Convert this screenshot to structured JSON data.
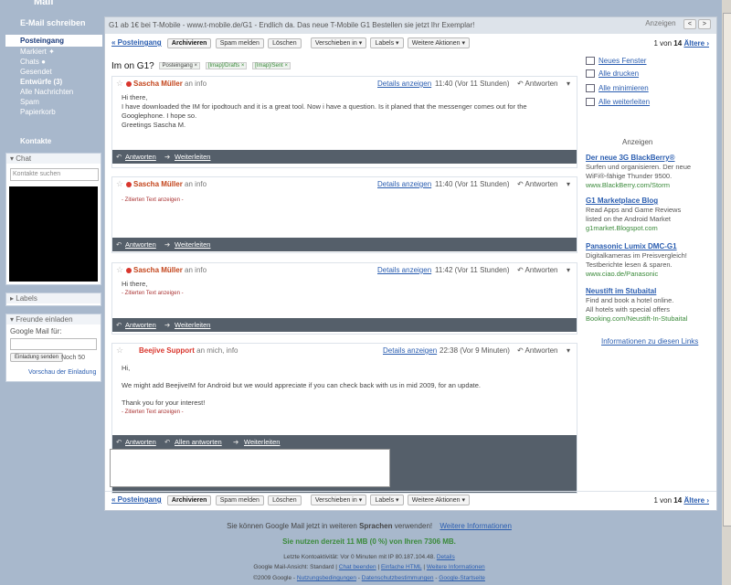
{
  "sidebar": {
    "logo_stub": "Mail",
    "compose": "E-Mail schreiben",
    "nav": [
      "Posteingang",
      "Markiert",
      "Chats",
      "Gesendet",
      "Entwürfe (3)",
      "Alle Nachrichten",
      "Spam",
      "Papierkorb"
    ],
    "contacts": "Kontakte",
    "chat_header": "Chat",
    "chat_search_placeholder": "Kontakte suchen",
    "labels_header": "Labels",
    "invite_header": "Freunde einladen",
    "invite_text": "Google Mail für:",
    "invite_button": "Einladung senden",
    "invite_remaining": "Noch 50",
    "invite_preview": "Vorschau der Einladung"
  },
  "adbar": {
    "ad_text": "G1 ab 1€ bei T-Mobile - www.t-mobile.de/G1 - Endlich da. Das neue T-Mobile G1 Bestellen sie jetzt Ihr Exemplar!",
    "right_label": "Anzeigen"
  },
  "toolbar": {
    "back": "« Posteingang",
    "archive": "Archivieren",
    "spam": "Spam melden",
    "delete": "Löschen",
    "move": "Verschieben in ▾",
    "labels": "Labels ▾",
    "more": "Weitere Aktionen ▾",
    "pagination_pre": "1 von",
    "pagination_total": "14",
    "older": "Ältere ›"
  },
  "thread": {
    "subject": "Im on G1?",
    "tags": [
      "Posteingang",
      "[Imap]/Drafts",
      "[Imap]/Sent"
    ]
  },
  "messages": [
    {
      "sender": "Sascha Müller",
      "to": "an info",
      "details": "Details anzeigen",
      "time": "11:40 (Vor 11 Stunden)",
      "reply": "Antworten",
      "body": [
        "Hi there,",
        "I have downloaded the IM for ipodtouch and it is a great tool. Now i have a question. Is it planed that the messenger comes out for the",
        "Googlephone. I hope so.",
        "Greetings Sascha M."
      ],
      "actions": [
        "Antworten",
        "Weiterleiten"
      ]
    },
    {
      "sender": "Sascha Müller",
      "to": "an info",
      "details": "Details anzeigen",
      "time": "11:40 (Vor 11 Stunden)",
      "reply": "Antworten",
      "quote": "- Zitierten Text anzeigen -",
      "actions": [
        "Antworten",
        "Weiterleiten"
      ]
    },
    {
      "sender": "Sascha Müller",
      "to": "an info",
      "details": "Details anzeigen",
      "time": "11:42 (Vor 11 Stunden)",
      "reply": "Antworten",
      "body": [
        "Hi there,"
      ],
      "quote": "- Zitierten Text anzeigen -",
      "actions": [
        "Antworten",
        "Weiterleiten"
      ]
    },
    {
      "sender": "Beejive Support",
      "to": "an mich, info",
      "details": "Details anzeigen",
      "time": "22:38 (Vor 9 Minuten)",
      "reply": "Antworten",
      "body": [
        "Hi,",
        "We might add BeejiveIM for Android but we would appreciate if you can check back with us in mid 2009, for an update.",
        "Thank you for your interest!"
      ],
      "quote": "- Zitierten Text anzeigen -",
      "actions": [
        "Antworten",
        "Allen antworten",
        "Weiterleiten"
      ]
    }
  ],
  "rightcol": {
    "links": [
      "Neues Fenster",
      "Alle drucken",
      "Alle minimieren",
      "Alle weiterleiten"
    ],
    "ads_title": "Anzeigen",
    "ads": [
      {
        "title": "Der neue 3G BlackBerry®",
        "lines": [
          "Surfen und organisieren. Der neue",
          "WiFi®-fähige Thunder 9500."
        ],
        "url": "www.BlackBerry.com/Storm"
      },
      {
        "title": "G1 Marketplace Blog",
        "lines": [
          "Read Apps and Game Reviews",
          "listed on the Android Market"
        ],
        "url": "g1market.Blogspot.com"
      },
      {
        "title": "Panasonic Lumix DMC-G1",
        "lines": [
          "Digitalkameras im Preisvergleich!",
          "Testberichte lesen & sparen."
        ],
        "url": "www.ciao.de/Panasonic"
      },
      {
        "title": "Neustift im Stubaital",
        "lines": [
          "Find and book a hotel online.",
          "All hotels with special offers"
        ],
        "url": "Booking.com/Neustift-In-Stubaital"
      }
    ],
    "ads_info": "Informationen zu diesen Links"
  },
  "footer": {
    "line1_pre": "Sie können Google Mail jetzt in weiteren",
    "line1_bold": "Sprachen",
    "line1_post": "verwenden!",
    "line1_link": "Weitere Informationen",
    "usage": "Sie nutzen derzeit 11 MB (0 %) von Ihren 7306 MB.",
    "activity": "Letzte Kontoaktivität: Vor 0 Minuten mit IP 80.187.104.48.",
    "activity_link": "Details",
    "view_pre": "Google Mail-Ansicht: Standard |",
    "view_link1": "Chat beenden",
    "view_link2": "Einfache HTML",
    "view_link3": "Weitere Informationen",
    "copyright": "©2009 Google -",
    "copy_link1": "Nutzungsbedingungen",
    "copy_link2": "Datenschutzbestimmungen",
    "copy_link3": "Google-Startseite"
  }
}
